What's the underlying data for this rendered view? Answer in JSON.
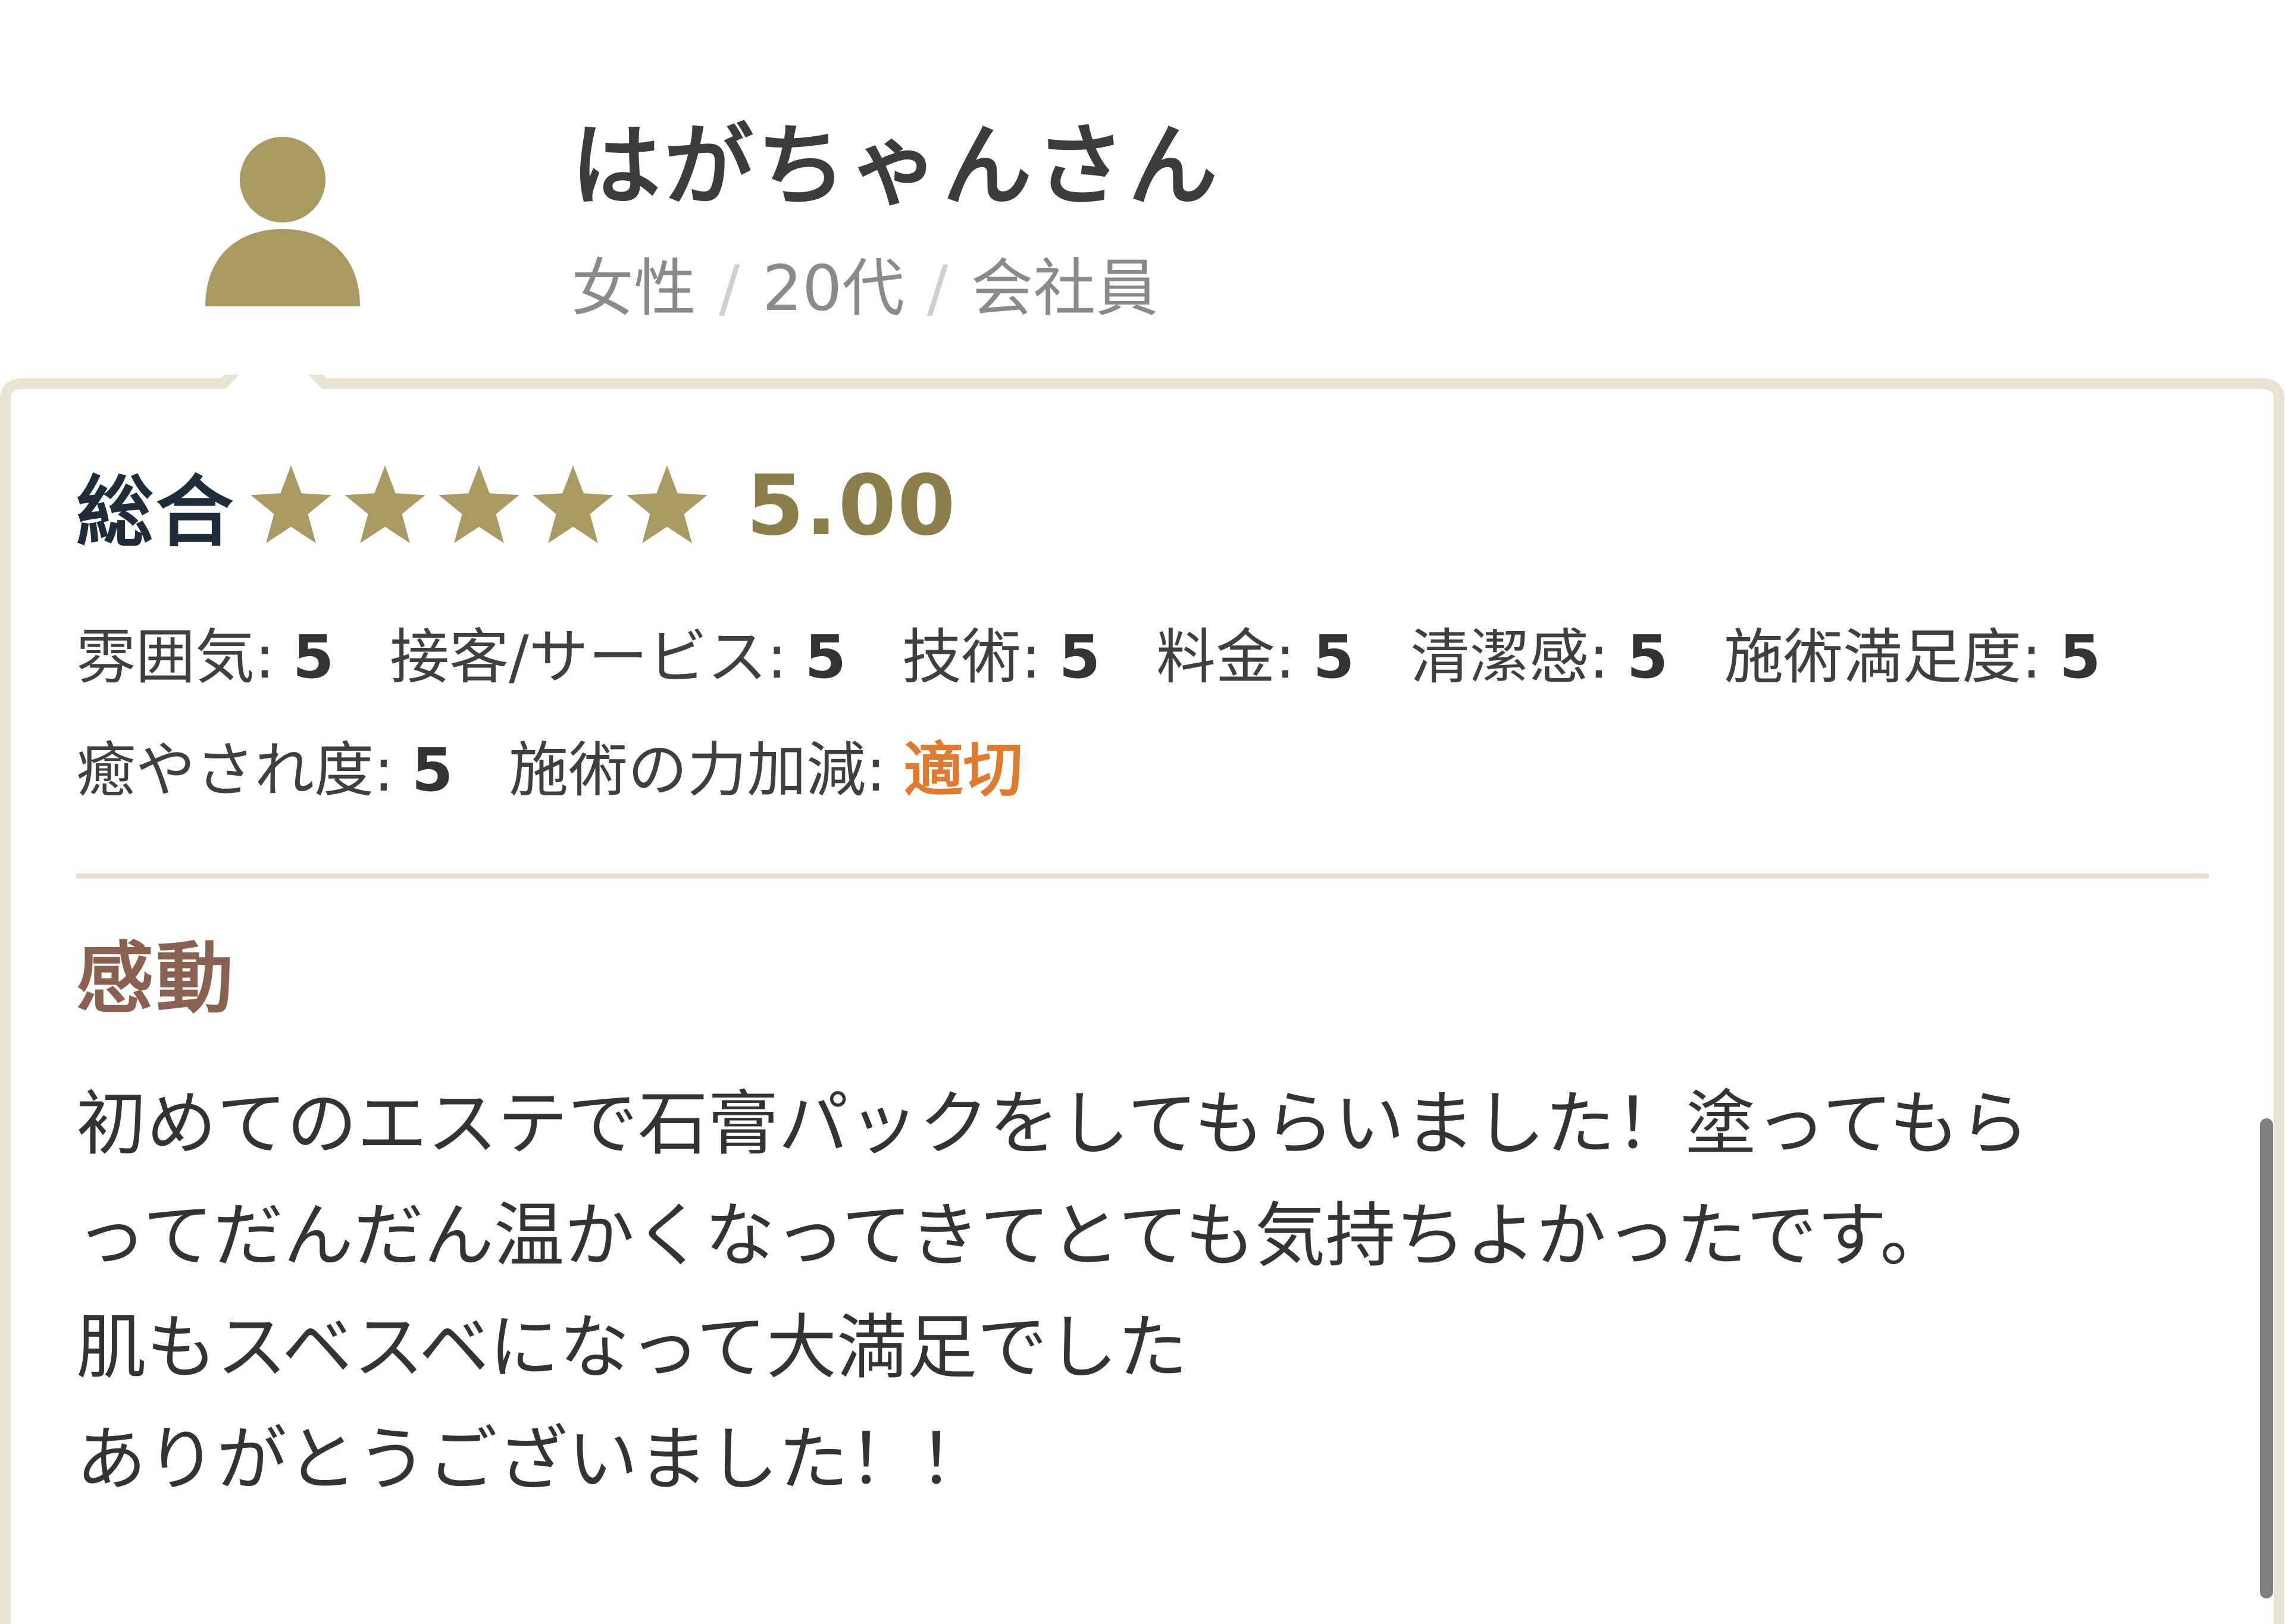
{
  "reviewer": {
    "name": "はがちゃんさん",
    "gender": "女性",
    "age": "20代",
    "occupation": "会社員",
    "separator": "/"
  },
  "rating": {
    "label": "総合",
    "score": "5.00",
    "stars": 5,
    "star_color": "#a89a63"
  },
  "metrics": [
    {
      "label": "雰囲気:",
      "value": "5"
    },
    {
      "label": "接客/サービス:",
      "value": "5"
    },
    {
      "label": "技術:",
      "value": "5"
    },
    {
      "label": "料金:",
      "value": "5"
    },
    {
      "label": "清潔感:",
      "value": "5"
    },
    {
      "label": "施術満足度:",
      "value": "5"
    },
    {
      "label": "癒やされ度:",
      "value": "5"
    },
    {
      "label": "施術の力加減:",
      "value": "適切"
    }
  ],
  "review": {
    "title": "感動",
    "body_lines": [
      "初めてのエステで石膏パックをしてもらいました！塗ってもら",
      "ってだんだん温かくなってきてとても気持ちよかったです。",
      "肌もスベスベになって大満足でした",
      "ありがとうございました！！"
    ]
  },
  "colors": {
    "avatar": "#a89a63",
    "card_border": "#e8e2d2",
    "accent_value": "#e07a2e",
    "review_title": "#8a6150"
  }
}
